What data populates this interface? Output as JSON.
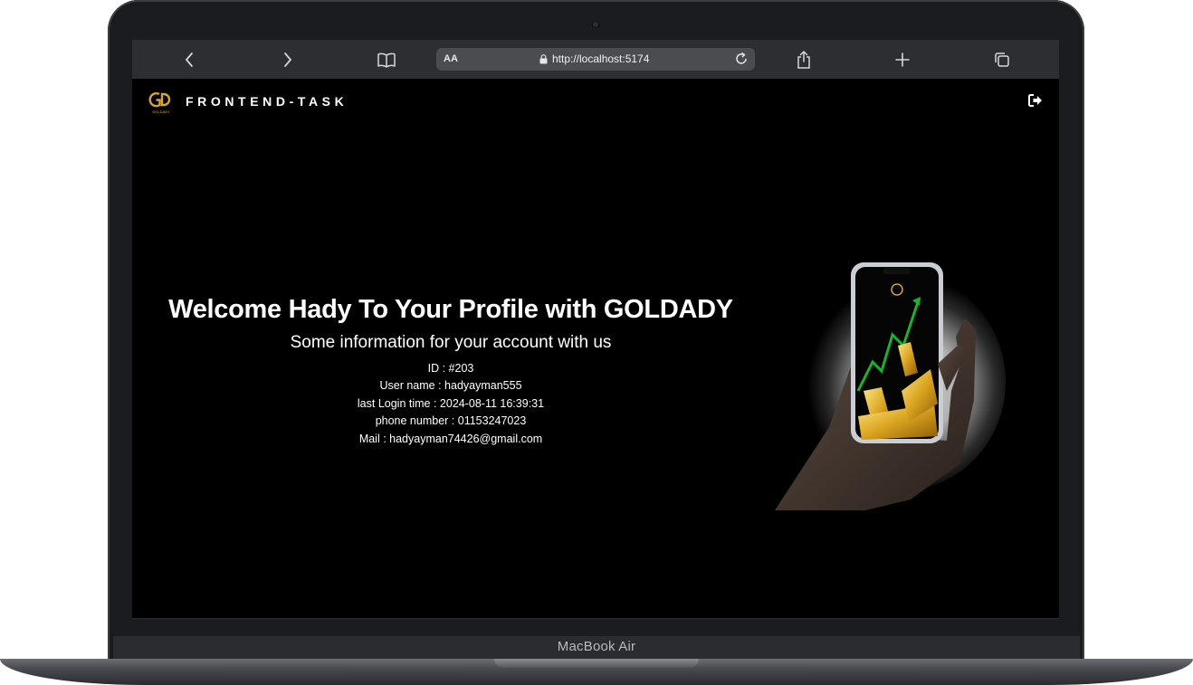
{
  "device": {
    "label": "MacBook Air"
  },
  "browser": {
    "text_size_label": "AA",
    "url": "http://localhost:5174"
  },
  "header": {
    "title": "FRONTEND-TASK",
    "logo_text": "GOLDADY"
  },
  "profile": {
    "heading": "Welcome Hady To Your Profile with GOLDADY",
    "subheading": "Some information for your account with us",
    "fields": [
      {
        "text": "ID : #203"
      },
      {
        "text": "User name : hadyayman555"
      },
      {
        "text": "last Login time : 2024-08-11 16:39:31"
      },
      {
        "text": "phone number : 01153247023"
      },
      {
        "text": "Mail : hadyayman74426@gmail.com"
      }
    ]
  },
  "colors": {
    "page_bg": "#000000",
    "toolbar_bg": "#2c2e31",
    "gold": "#d4a437",
    "chart_green": "#1fb02b"
  },
  "icons": [
    "back-icon",
    "forward-icon",
    "bookmarks-icon",
    "lock-icon",
    "reload-icon",
    "share-icon",
    "new-tab-icon",
    "tabs-icon",
    "logout-icon"
  ]
}
